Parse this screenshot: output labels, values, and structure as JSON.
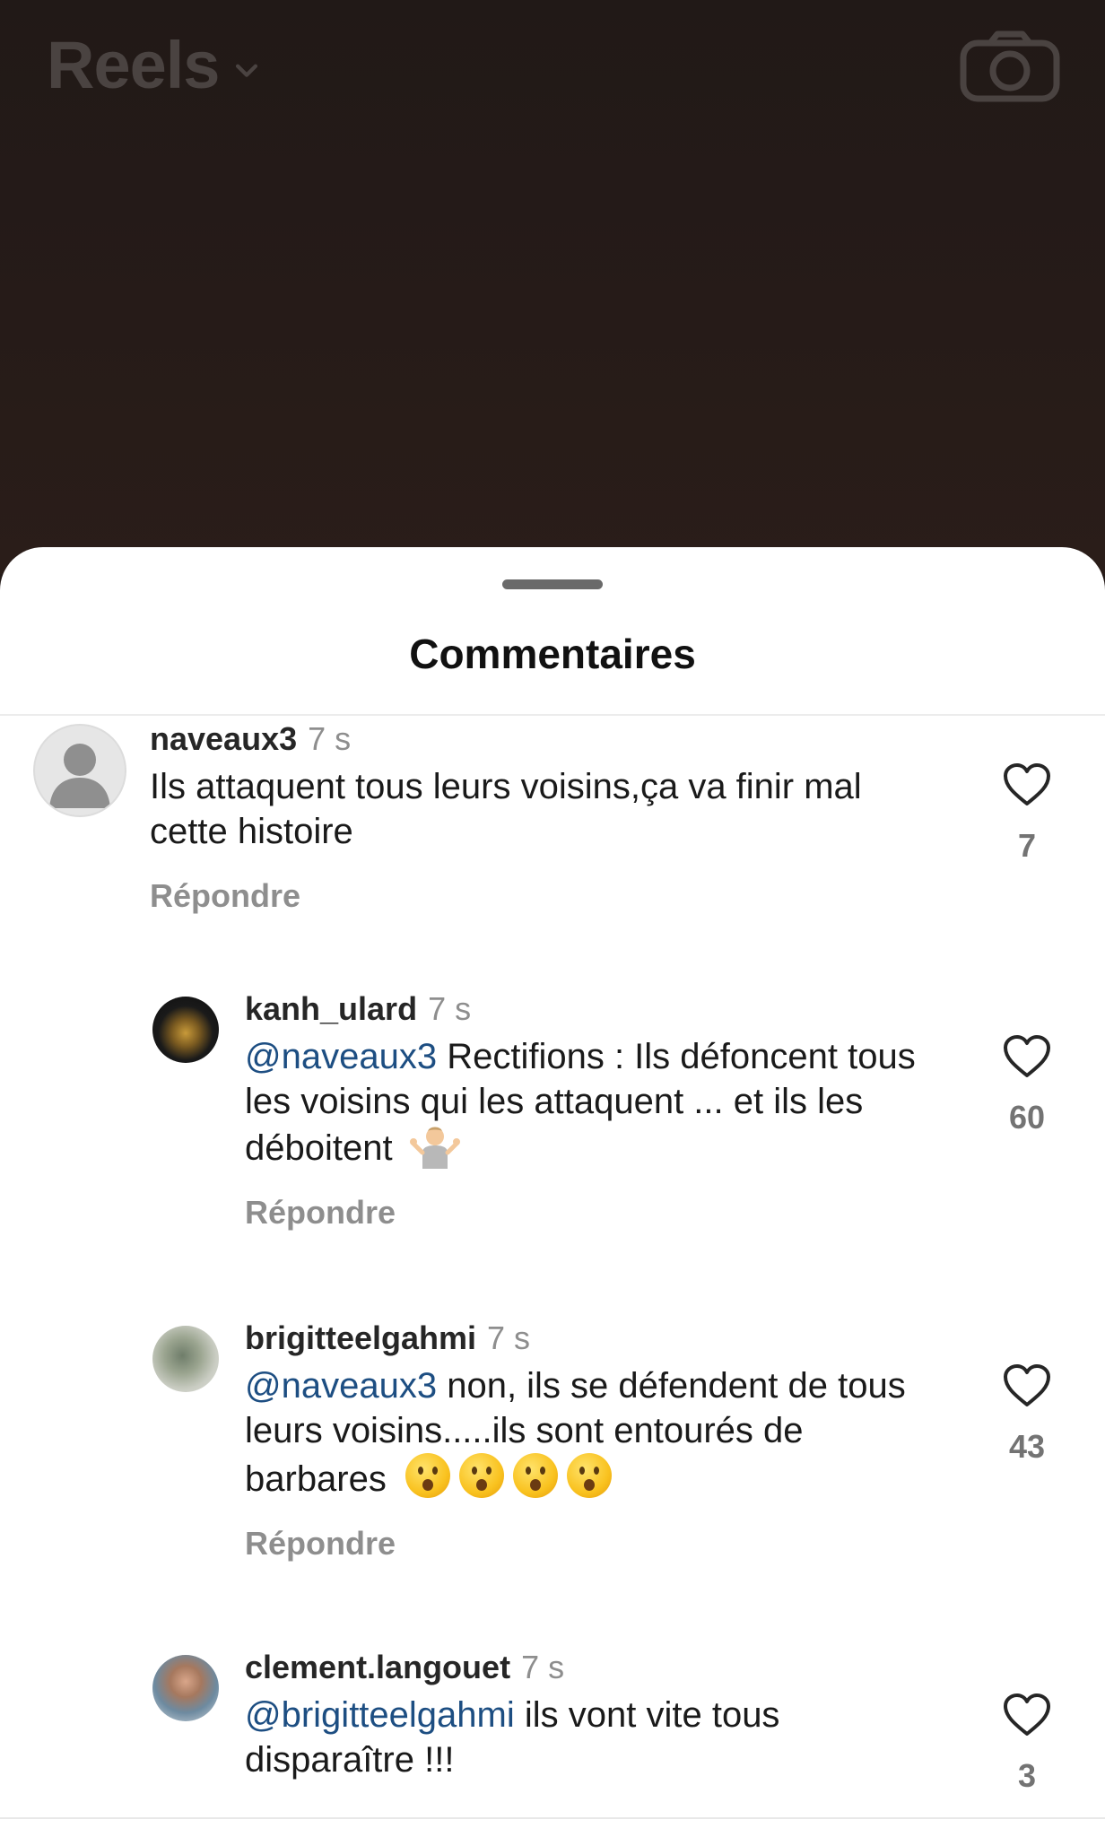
{
  "header": {
    "title": "Reels"
  },
  "sheet": {
    "title": "Commentaires"
  },
  "comments": [
    {
      "username": "naveaux3",
      "time": "7 s",
      "mention": "",
      "text": "Ils attaquent tous leurs voisins,ça va finir mal cette histoire",
      "reply_label": "Répondre",
      "likes": "7"
    },
    {
      "username": "kanh_ulard",
      "time": "7 s",
      "mention": "@naveaux3",
      "text": " Rectifions : Ils défoncent tous les voisins qui les attaquent ... et ils les déboitent",
      "reply_label": "Répondre",
      "likes": "60"
    },
    {
      "username": "brigitteelgahmi",
      "time": "7 s",
      "mention": "@naveaux3",
      "text": " non, ils se défendent de tous leurs voisins.....ils sont entourés de barbares",
      "reply_label": "Répondre",
      "likes": "43"
    },
    {
      "username": "clement.langouet",
      "time": "7 s",
      "mention": "@brigitteelgahmi",
      "text": " ils vont vite tous disparaître !!!",
      "reply_label": "",
      "likes": "3"
    }
  ],
  "icons": {
    "camera": "camera-icon",
    "chevron": "chevron-down-icon",
    "heart": "heart-outline-icon"
  }
}
